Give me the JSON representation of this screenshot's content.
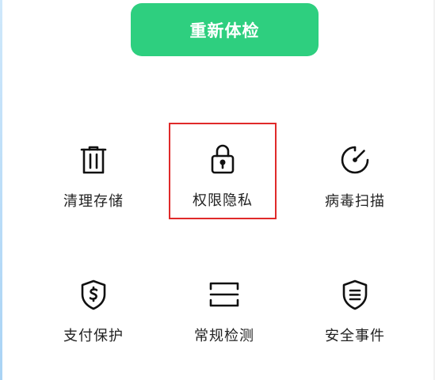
{
  "action_button": {
    "label": "重新体检"
  },
  "tiles": [
    {
      "label": "清理存储",
      "icon": "trash-icon"
    },
    {
      "label": "权限隐私",
      "icon": "lock-icon",
      "selected": true
    },
    {
      "label": "病毒扫描",
      "icon": "gauge-icon"
    },
    {
      "label": "支付保护",
      "icon": "shield-dollar-icon"
    },
    {
      "label": "常规检测",
      "icon": "scan-icon"
    },
    {
      "label": "安全事件",
      "icon": "shield-list-icon"
    }
  ],
  "colors": {
    "accent": "#2ecf7f",
    "selection": "#e02a2a",
    "icon": "#111111",
    "text": "#222222"
  }
}
